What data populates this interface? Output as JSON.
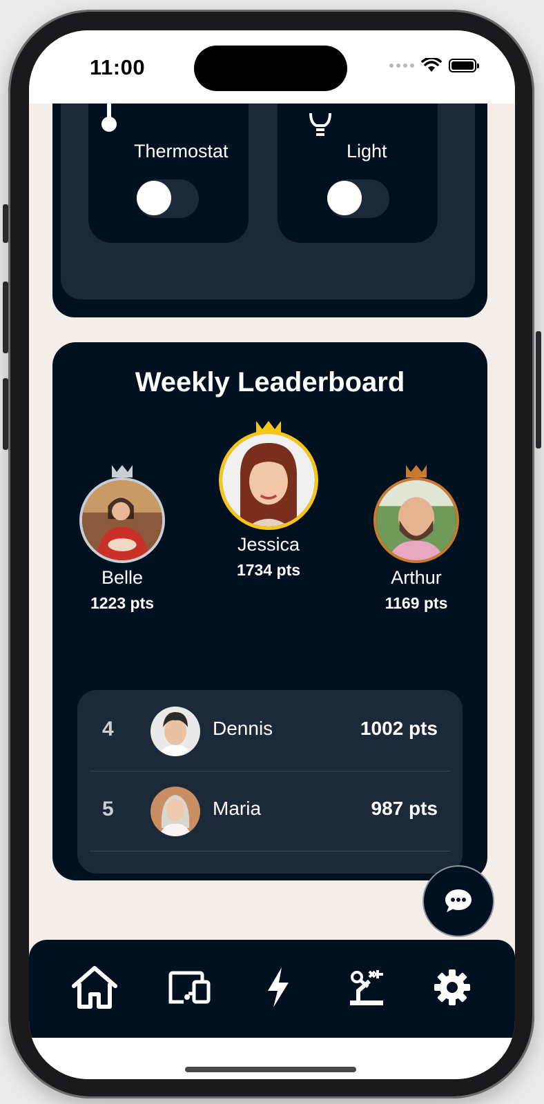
{
  "status_bar": {
    "time": "11:00",
    "icons": [
      "cellular-dots-icon",
      "wifi-icon",
      "battery-icon"
    ]
  },
  "devices": [
    {
      "label": "Thermostat",
      "icon": "thermometer-icon",
      "on": false
    },
    {
      "label": "Light",
      "icon": "lightbulb-icon",
      "on": false
    }
  ],
  "leaderboard": {
    "title": "Weekly Leaderboard",
    "podium": [
      {
        "place": 2,
        "name": "Belle",
        "points": "1223 pts",
        "crown_color": "#c9ced4"
      },
      {
        "place": 1,
        "name": "Jessica",
        "points": "1734 pts",
        "crown_color": "#f5c518"
      },
      {
        "place": 3,
        "name": "Arthur",
        "points": "1169 pts",
        "crown_color": "#c97a2e"
      }
    ],
    "rows": [
      {
        "rank": "4",
        "name": "Dennis",
        "points": "1002 pts"
      },
      {
        "rank": "5",
        "name": "Maria",
        "points": "987 pts"
      }
    ]
  },
  "chat_button": {
    "icon": "chat-bubble-icon"
  },
  "tab_bar": {
    "tabs": [
      {
        "id": "home",
        "icon": "home-icon",
        "active": true
      },
      {
        "id": "devices",
        "icon": "devices-icon",
        "active": false
      },
      {
        "id": "energy",
        "icon": "lightning-icon",
        "active": false
      },
      {
        "id": "automation",
        "icon": "robot-arm-icon",
        "active": false
      },
      {
        "id": "settings",
        "icon": "gear-icon",
        "active": false
      }
    ]
  },
  "colors": {
    "card_dark": "#02111f",
    "card_mid": "#1c2939",
    "background": "#f3eee9",
    "gold": "#f5c518",
    "silver": "#c9ced4",
    "bronze": "#c97a2e"
  }
}
